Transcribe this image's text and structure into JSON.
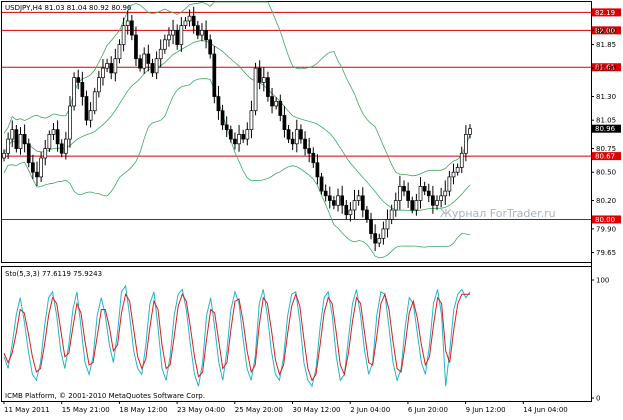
{
  "window": {
    "chart_title": "USDJPY,H4 81.03 81.04 80.92 80.96",
    "indicator_title": "Sto(5,3,3) 77.6119 75.9243",
    "footer": "ICMB Platform, © 2001-2010 MetaQuotes Software Corp.",
    "watermark": "Журнал ForTrader.ru"
  },
  "colors": {
    "background": "#ffffff",
    "candle": "#000000",
    "bollinger": "#3fa864",
    "level_line": "#d40000",
    "level_label_bg": "#e00000",
    "current_label_bg": "#000000",
    "stoch_main": "#27b3c8",
    "stoch_signal": "#d42020",
    "watermark": "#aab4bc"
  },
  "chart_data": {
    "type": "candlestick",
    "price_scale": {
      "min": 79.55,
      "max": 82.3,
      "ticks": [
        "82.00",
        "81.85",
        "81.60",
        "81.30",
        "81.05",
        "80.75",
        "80.50",
        "80.20",
        "79.90",
        "79.65"
      ]
    },
    "level_lines": [
      {
        "value": 82.19,
        "label": "82.19"
      },
      {
        "value": 82.0,
        "label": "82.00"
      },
      {
        "value": 81.61,
        "label": "81.61"
      },
      {
        "value": 80.67,
        "label": "80.67"
      },
      {
        "value": 80.0,
        "label": "80.00"
      }
    ],
    "current_price": {
      "value": 80.96,
      "label": "80.96"
    },
    "time_labels": [
      "11 May 2011",
      "15 May 21:00",
      "18 May 12:00",
      "23 May 04:00",
      "25 May 20:00",
      "30 May 12:00",
      "2 Jun 04:00",
      "6 Jun 20:00",
      "9 Jun 12:00",
      "14 Jun 04:00"
    ],
    "close_path": [
      80.7,
      80.85,
      80.95,
      80.75,
      80.9,
      80.8,
      80.6,
      80.5,
      80.45,
      80.65,
      80.75,
      80.9,
      80.95,
      80.8,
      80.7,
      80.85,
      81.2,
      81.5,
      81.45,
      81.3,
      81.05,
      81.15,
      81.35,
      81.5,
      81.6,
      81.65,
      81.55,
      81.7,
      81.85,
      82.05,
      82.1,
      81.95,
      81.7,
      81.6,
      81.75,
      81.65,
      81.55,
      81.7,
      81.8,
      81.9,
      81.95,
      82.0,
      81.85,
      82.05,
      82.1,
      82.15,
      82.05,
      81.95,
      82.0,
      81.9,
      81.75,
      81.3,
      81.15,
      81.0,
      80.95,
      80.85,
      80.8,
      80.9,
      80.85,
      80.95,
      81.15,
      81.6,
      81.45,
      81.5,
      81.3,
      81.2,
      81.25,
      81.1,
      80.95,
      80.85,
      80.8,
      80.95,
      80.85,
      80.75,
      80.7,
      80.6,
      80.45,
      80.3,
      80.25,
      80.2,
      80.15,
      80.25,
      80.15,
      80.05,
      80.1,
      80.2,
      80.25,
      80.1,
      80.0,
      79.85,
      79.75,
      79.8,
      79.9,
      80.0,
      80.1,
      80.2,
      80.35,
      80.3,
      80.2,
      80.1,
      80.2,
      80.35,
      80.3,
      80.25,
      80.15,
      80.2,
      80.25,
      80.3,
      80.45,
      80.5,
      80.55,
      80.7,
      80.9,
      80.96
    ],
    "stochastic": {
      "scale": {
        "min": 0,
        "max": 100,
        "ticks": [
          "100",
          "0"
        ]
      },
      "main": [
        35,
        25,
        45,
        70,
        85,
        65,
        40,
        20,
        15,
        30,
        60,
        85,
        90,
        70,
        40,
        25,
        45,
        75,
        90,
        60,
        30,
        20,
        35,
        70,
        85,
        70,
        45,
        30,
        55,
        90,
        95,
        70,
        40,
        25,
        20,
        45,
        80,
        90,
        60,
        25,
        15,
        35,
        70,
        88,
        92,
        75,
        45,
        20,
        10,
        30,
        70,
        85,
        60,
        30,
        15,
        40,
        75,
        90,
        80,
        50,
        25,
        15,
        35,
        80,
        92,
        70,
        40,
        20,
        15,
        35,
        70,
        88,
        90,
        65,
        30,
        15,
        10,
        25,
        60,
        85,
        90,
        70,
        35,
        15,
        20,
        50,
        80,
        92,
        70,
        40,
        20,
        30,
        70,
        90,
        88,
        60,
        30,
        15,
        25,
        60,
        85,
        80,
        55,
        30,
        20,
        45,
        80,
        92,
        70,
        10,
        40,
        75,
        88,
        92,
        85,
        90
      ],
      "signal": [
        38,
        30,
        38,
        55,
        75,
        72,
        55,
        35,
        22,
        25,
        45,
        70,
        85,
        80,
        58,
        35,
        38,
        60,
        80,
        72,
        48,
        28,
        30,
        52,
        75,
        75,
        60,
        40,
        45,
        72,
        88,
        82,
        58,
        35,
        25,
        33,
        60,
        82,
        75,
        45,
        25,
        28,
        52,
        78,
        88,
        82,
        60,
        35,
        18,
        22,
        50,
        75,
        72,
        48,
        25,
        30,
        58,
        82,
        84,
        65,
        40,
        22,
        28,
        62,
        85,
        80,
        58,
        32,
        20,
        28,
        55,
        78,
        88,
        78,
        50,
        25,
        15,
        20,
        45,
        72,
        85,
        80,
        55,
        28,
        20,
        38,
        65,
        85,
        80,
        55,
        30,
        28,
        52,
        80,
        88,
        75,
        48,
        25,
        22,
        45,
        72,
        82,
        68,
        45,
        28,
        35,
        62,
        85,
        80,
        40,
        30,
        58,
        80,
        88,
        88,
        88
      ]
    }
  }
}
